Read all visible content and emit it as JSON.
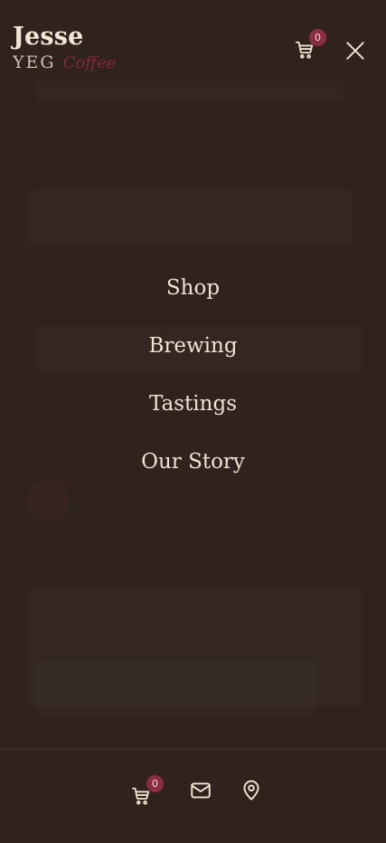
{
  "header": {
    "brand_name": "Jesse",
    "brand_city": "YEG",
    "brand_product": "Coffee",
    "cart_count": "0",
    "cart_icon": "cart-icon",
    "close_icon": "close-icon"
  },
  "nav": {
    "items": [
      {
        "label": "Shop"
      },
      {
        "label": "Brewing"
      },
      {
        "label": "Tastings"
      },
      {
        "label": "Our Story"
      }
    ]
  },
  "bottom_bar": {
    "cart_count": "0",
    "cart_icon": "cart-icon",
    "mail_icon": "mail-icon",
    "location_icon": "location-pin-icon"
  },
  "colors": {
    "background": "#30231e",
    "text": "#efe3d2",
    "accent": "#8c2d44",
    "brand_product": "#7d2a3c"
  }
}
